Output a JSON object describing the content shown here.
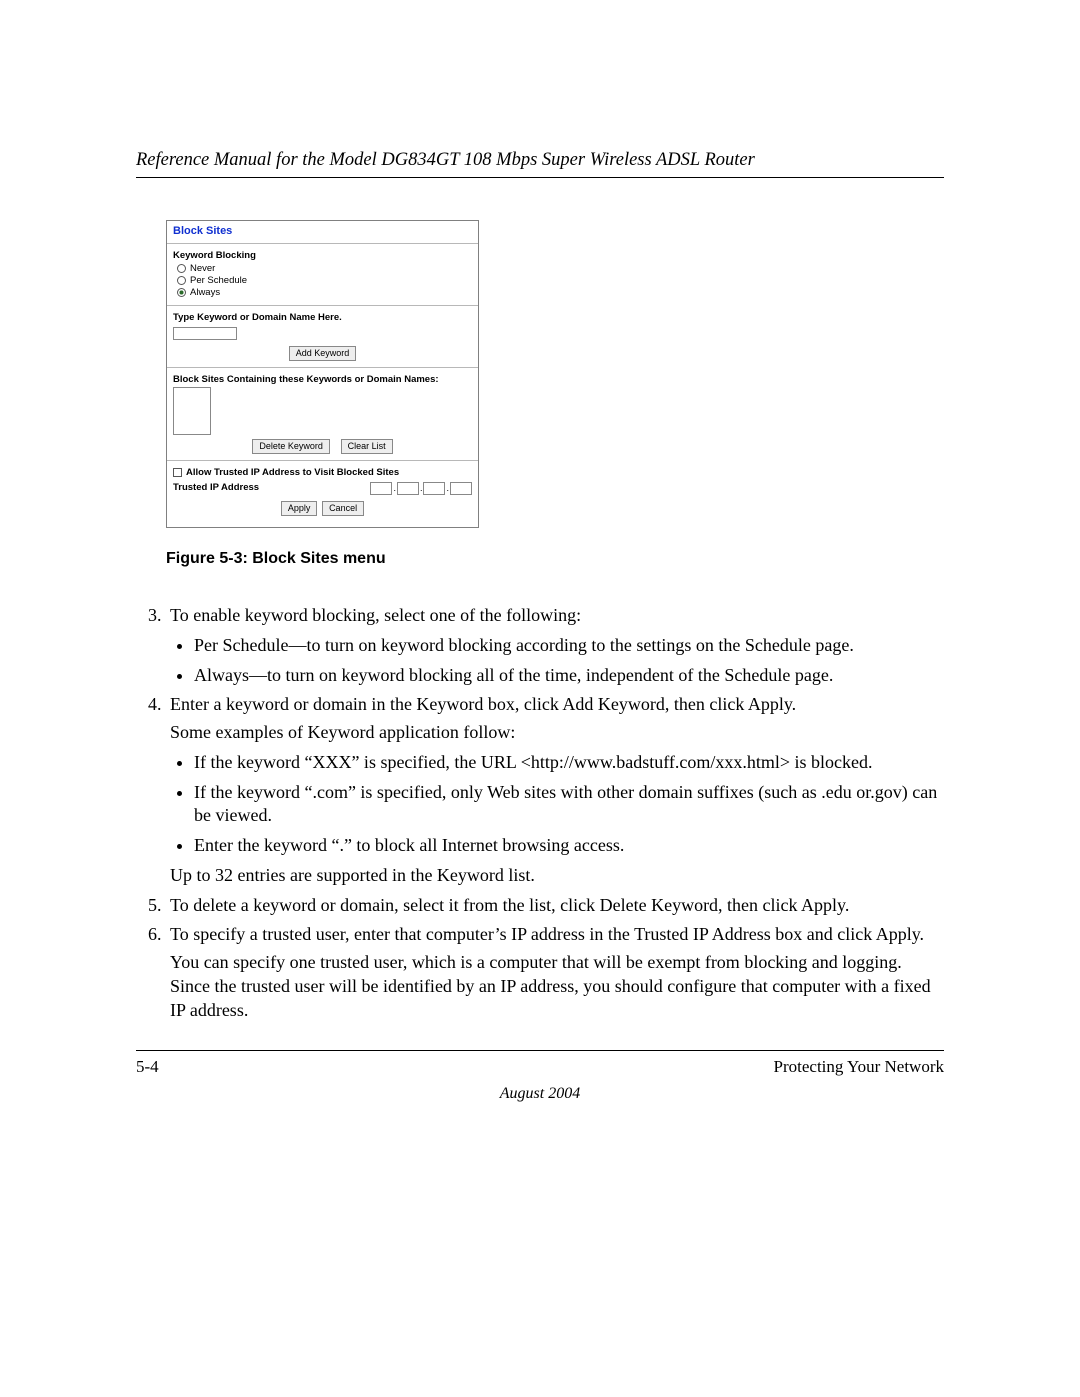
{
  "header": {
    "title": "Reference Manual for the Model DG834GT 108 Mbps Super Wireless ADSL Router"
  },
  "screenshot": {
    "title": "Block Sites",
    "keyword_blocking_heading": "Keyword Blocking",
    "radios": {
      "never": "Never",
      "per_schedule": "Per Schedule",
      "always": "Always"
    },
    "type_keyword_heading": "Type Keyword or Domain Name Here.",
    "add_keyword_btn": "Add Keyword",
    "block_list_heading": "Block Sites Containing these Keywords or Domain Names:",
    "delete_keyword_btn": "Delete Keyword",
    "clear_list_btn": "Clear List",
    "allow_trusted_label": "Allow Trusted IP Address to Visit Blocked Sites",
    "trusted_ip_label": "Trusted IP Address",
    "apply_btn": "Apply",
    "cancel_btn": "Cancel"
  },
  "figure_caption": "Figure 5-3:  Block Sites menu",
  "list": {
    "start": 3,
    "item3": {
      "text": "To enable keyword blocking, select one of the following:",
      "b1": "Per Schedule—to turn on keyword blocking according to the settings on the Schedule page.",
      "b2": "Always—to turn on keyword blocking all of the time, independent of the Schedule page."
    },
    "item4": {
      "text1": "Enter a keyword or domain in the Keyword box, click Add Keyword, then click Apply.",
      "text2": "Some examples of Keyword application follow:",
      "b1": "If the keyword “XXX” is specified, the URL <http://www.badstuff.com/xxx.html> is blocked.",
      "b2": "If the keyword “.com” is specified, only Web sites with other domain suffixes (such as .edu or.gov) can be viewed.",
      "b3": "Enter the keyword “.” to block all Internet browsing access.",
      "tail": "Up to 32 entries are supported in the Keyword list."
    },
    "item5": "To delete a keyword or domain, select it from the list, click Delete Keyword, then click Apply.",
    "item6": {
      "text1": "To specify a trusted user, enter that computer’s IP address in the Trusted IP Address box and click Apply.",
      "text2": "You can specify one trusted user, which is a computer that will be exempt from blocking and logging. Since the trusted user will be identified by an IP address, you should configure that computer with a fixed IP address."
    }
  },
  "footer": {
    "page": "5-4",
    "section": "Protecting Your Network",
    "date": "August 2004"
  }
}
